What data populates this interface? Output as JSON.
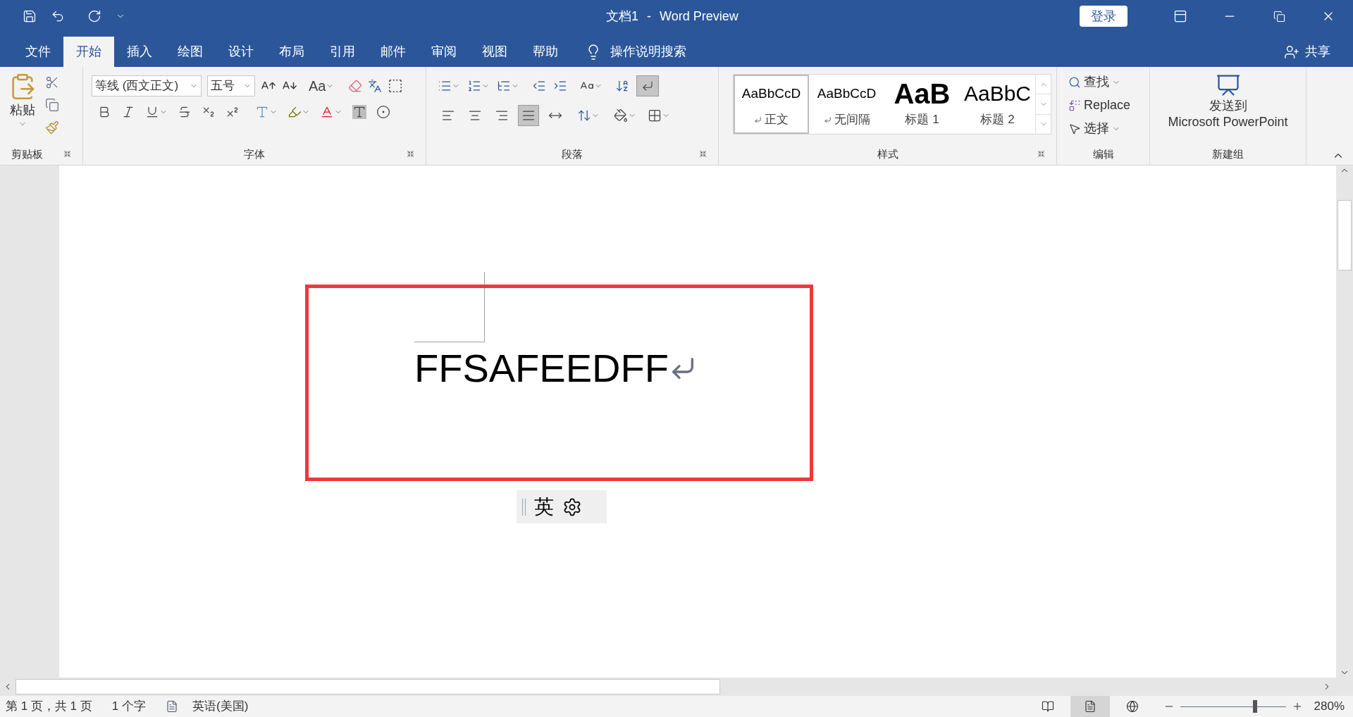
{
  "title_bar": {
    "document_title": "文档1",
    "separator": "-",
    "app": "Word Preview",
    "login_button": "登录"
  },
  "tabs": [
    {
      "label": "文件",
      "selected": false
    },
    {
      "label": "开始",
      "selected": true
    },
    {
      "label": "插入",
      "selected": false
    },
    {
      "label": "绘图",
      "selected": false
    },
    {
      "label": "设计",
      "selected": false
    },
    {
      "label": "布局",
      "selected": false
    },
    {
      "label": "引用",
      "selected": false
    },
    {
      "label": "邮件",
      "selected": false
    },
    {
      "label": "审阅",
      "selected": false
    },
    {
      "label": "视图",
      "selected": false
    },
    {
      "label": "帮助",
      "selected": false
    }
  ],
  "tell_me": "操作说明搜索",
  "share": "共享",
  "ribbon": {
    "clipboard": {
      "paste": "粘贴",
      "group_label": "剪贴板"
    },
    "font": {
      "name": "等线 (西文正文)",
      "size": "五号",
      "change_case": "Aa",
      "group_label": "字体"
    },
    "paragraph": {
      "align_buttons": [
        {
          "kind": "left",
          "selected": false
        },
        {
          "kind": "center",
          "selected": false
        },
        {
          "kind": "right",
          "selected": false
        },
        {
          "kind": "justify",
          "selected": true
        },
        {
          "kind": "distributed",
          "selected": false
        }
      ],
      "show_marks": {
        "selected": true
      },
      "group_label": "段落"
    },
    "styles": {
      "items": [
        {
          "preview": "AaBbCcD",
          "label": "正文",
          "kind": "normal",
          "selected": true
        },
        {
          "preview": "AaBbCcD",
          "label": "无间隔",
          "kind": "normal",
          "selected": false
        },
        {
          "preview": "AaB",
          "label": "标题 1",
          "kind": "heading1",
          "selected": false
        },
        {
          "preview": "AaBbC",
          "label": "标题 2",
          "kind": "heading2",
          "selected": false
        }
      ],
      "group_label": "样式"
    },
    "editing": {
      "find": "查找",
      "replace": "Replace",
      "select": "选择",
      "group_label": "编辑"
    },
    "new_group": {
      "send": "发送到",
      "target": "Microsoft PowerPoint",
      "group_label": "新建组"
    }
  },
  "document": {
    "text": "FFSAFEEDFF"
  },
  "ime_bar": {
    "mode": "英"
  },
  "status_bar": {
    "page": "第 1 页，共 1 页",
    "words": "1 个字",
    "language": "英语(美国)",
    "views": [
      {
        "kind": "read",
        "selected": false
      },
      {
        "kind": "print",
        "selected": true
      },
      {
        "kind": "web",
        "selected": false
      }
    ],
    "zoom": {
      "level": 0.71,
      "reading": "280%"
    }
  }
}
